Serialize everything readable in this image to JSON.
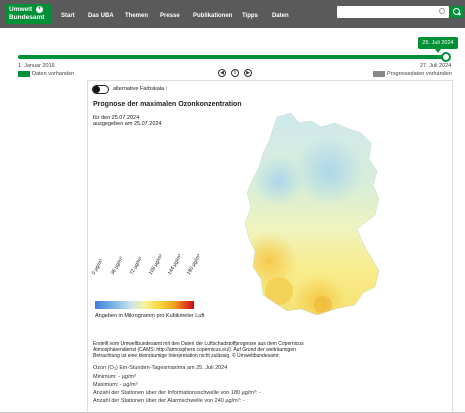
{
  "header": {
    "logo_line1": "Umwelt",
    "logo_line2": "Bundesamt",
    "nav": [
      "Start",
      "Das UBA",
      "Themen",
      "Presse",
      "Publikationen",
      "Tipps",
      "Daten"
    ],
    "search_placeholder": ""
  },
  "timeline": {
    "current_date": "25. Juli 2024",
    "start_label": "1. Januar 2016",
    "end_label": "27. Juli 2024",
    "legend_data": "Daten vorhanden",
    "legend_forecast": "Prognosedaten vorhanden",
    "colors": {
      "data": "#009036",
      "forecast": "#888888"
    }
  },
  "controls": {
    "prev_icon": "chevron-left-icon",
    "pause_icon": "pause-icon",
    "next_icon": "chevron-right-icon"
  },
  "toggle": {
    "label": "alternative Farbskala",
    "info": "i"
  },
  "map": {
    "title": "Prognose der maximalen Ozonkonzentration",
    "date_line1": "für den 25.07.2024",
    "date_line2": "ausgegeben am 25.07.2024",
    "scale_ticks": [
      "0 µg/m³",
      "36 µg/m³",
      "72 µg/m³",
      "108 µg/m³",
      "144 µg/m³",
      "180 µg/m³"
    ],
    "scale_caption": "Angeben in Mikrogramm pro Kubikmeter Luft",
    "footnote_1": "Erstellt vom Umweltbundesamt mit den Daten der Luftschadstoffprognose aus dem Copernicus",
    "footnote_2": "Atmosphärendienst (CAMS: http://atmosphere.copernicus.eu/). Auf Grund der weiträumigen",
    "footnote_3": "Betrachtung ist eine kleinräumige Interpretation nicht zulässig. © Umweltbundesamt"
  },
  "stats": {
    "heading": "Ozon (O₃) Ein-Stunden-Tagesmaxima am 25. Juli 2024",
    "min": "Minimum: - µg/m³",
    "max": "Maximum: - µg/m³",
    "info_threshold": "Anzahl der Stationen über der Informationsschwelle von 180 µg/m³: -",
    "alarm_threshold": "Anzahl der Stationen über der Alarmschwelle von 240 µg/m³: -"
  }
}
